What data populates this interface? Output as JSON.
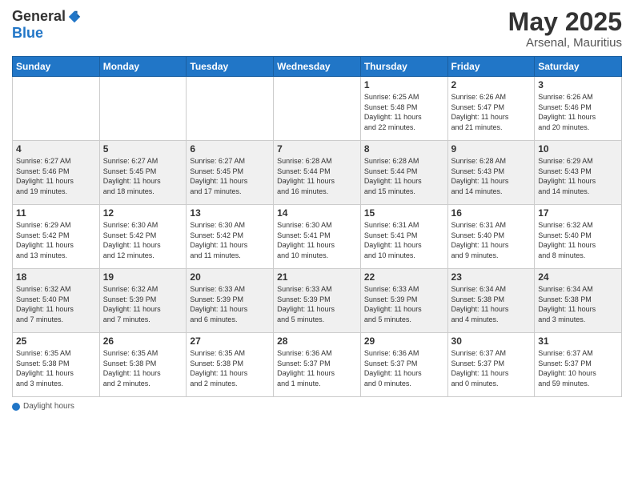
{
  "header": {
    "logo_general": "General",
    "logo_blue": "Blue",
    "month": "May 2025",
    "location": "Arsenal, Mauritius"
  },
  "days_of_week": [
    "Sunday",
    "Monday",
    "Tuesday",
    "Wednesday",
    "Thursday",
    "Friday",
    "Saturday"
  ],
  "footer": {
    "label": "Daylight hours"
  },
  "weeks": [
    [
      {
        "day": "",
        "info": ""
      },
      {
        "day": "",
        "info": ""
      },
      {
        "day": "",
        "info": ""
      },
      {
        "day": "",
        "info": ""
      },
      {
        "day": "1",
        "info": "Sunrise: 6:25 AM\nSunset: 5:48 PM\nDaylight: 11 hours\nand 22 minutes."
      },
      {
        "day": "2",
        "info": "Sunrise: 6:26 AM\nSunset: 5:47 PM\nDaylight: 11 hours\nand 21 minutes."
      },
      {
        "day": "3",
        "info": "Sunrise: 6:26 AM\nSunset: 5:46 PM\nDaylight: 11 hours\nand 20 minutes."
      }
    ],
    [
      {
        "day": "4",
        "info": "Sunrise: 6:27 AM\nSunset: 5:46 PM\nDaylight: 11 hours\nand 19 minutes."
      },
      {
        "day": "5",
        "info": "Sunrise: 6:27 AM\nSunset: 5:45 PM\nDaylight: 11 hours\nand 18 minutes."
      },
      {
        "day": "6",
        "info": "Sunrise: 6:27 AM\nSunset: 5:45 PM\nDaylight: 11 hours\nand 17 minutes."
      },
      {
        "day": "7",
        "info": "Sunrise: 6:28 AM\nSunset: 5:44 PM\nDaylight: 11 hours\nand 16 minutes."
      },
      {
        "day": "8",
        "info": "Sunrise: 6:28 AM\nSunset: 5:44 PM\nDaylight: 11 hours\nand 15 minutes."
      },
      {
        "day": "9",
        "info": "Sunrise: 6:28 AM\nSunset: 5:43 PM\nDaylight: 11 hours\nand 14 minutes."
      },
      {
        "day": "10",
        "info": "Sunrise: 6:29 AM\nSunset: 5:43 PM\nDaylight: 11 hours\nand 14 minutes."
      }
    ],
    [
      {
        "day": "11",
        "info": "Sunrise: 6:29 AM\nSunset: 5:42 PM\nDaylight: 11 hours\nand 13 minutes."
      },
      {
        "day": "12",
        "info": "Sunrise: 6:30 AM\nSunset: 5:42 PM\nDaylight: 11 hours\nand 12 minutes."
      },
      {
        "day": "13",
        "info": "Sunrise: 6:30 AM\nSunset: 5:42 PM\nDaylight: 11 hours\nand 11 minutes."
      },
      {
        "day": "14",
        "info": "Sunrise: 6:30 AM\nSunset: 5:41 PM\nDaylight: 11 hours\nand 10 minutes."
      },
      {
        "day": "15",
        "info": "Sunrise: 6:31 AM\nSunset: 5:41 PM\nDaylight: 11 hours\nand 10 minutes."
      },
      {
        "day": "16",
        "info": "Sunrise: 6:31 AM\nSunset: 5:40 PM\nDaylight: 11 hours\nand 9 minutes."
      },
      {
        "day": "17",
        "info": "Sunrise: 6:32 AM\nSunset: 5:40 PM\nDaylight: 11 hours\nand 8 minutes."
      }
    ],
    [
      {
        "day": "18",
        "info": "Sunrise: 6:32 AM\nSunset: 5:40 PM\nDaylight: 11 hours\nand 7 minutes."
      },
      {
        "day": "19",
        "info": "Sunrise: 6:32 AM\nSunset: 5:39 PM\nDaylight: 11 hours\nand 7 minutes."
      },
      {
        "day": "20",
        "info": "Sunrise: 6:33 AM\nSunset: 5:39 PM\nDaylight: 11 hours\nand 6 minutes."
      },
      {
        "day": "21",
        "info": "Sunrise: 6:33 AM\nSunset: 5:39 PM\nDaylight: 11 hours\nand 5 minutes."
      },
      {
        "day": "22",
        "info": "Sunrise: 6:33 AM\nSunset: 5:39 PM\nDaylight: 11 hours\nand 5 minutes."
      },
      {
        "day": "23",
        "info": "Sunrise: 6:34 AM\nSunset: 5:38 PM\nDaylight: 11 hours\nand 4 minutes."
      },
      {
        "day": "24",
        "info": "Sunrise: 6:34 AM\nSunset: 5:38 PM\nDaylight: 11 hours\nand 3 minutes."
      }
    ],
    [
      {
        "day": "25",
        "info": "Sunrise: 6:35 AM\nSunset: 5:38 PM\nDaylight: 11 hours\nand 3 minutes."
      },
      {
        "day": "26",
        "info": "Sunrise: 6:35 AM\nSunset: 5:38 PM\nDaylight: 11 hours\nand 2 minutes."
      },
      {
        "day": "27",
        "info": "Sunrise: 6:35 AM\nSunset: 5:38 PM\nDaylight: 11 hours\nand 2 minutes."
      },
      {
        "day": "28",
        "info": "Sunrise: 6:36 AM\nSunset: 5:37 PM\nDaylight: 11 hours\nand 1 minute."
      },
      {
        "day": "29",
        "info": "Sunrise: 6:36 AM\nSunset: 5:37 PM\nDaylight: 11 hours\nand 0 minutes."
      },
      {
        "day": "30",
        "info": "Sunrise: 6:37 AM\nSunset: 5:37 PM\nDaylight: 11 hours\nand 0 minutes."
      },
      {
        "day": "31",
        "info": "Sunrise: 6:37 AM\nSunset: 5:37 PM\nDaylight: 10 hours\nand 59 minutes."
      }
    ]
  ]
}
